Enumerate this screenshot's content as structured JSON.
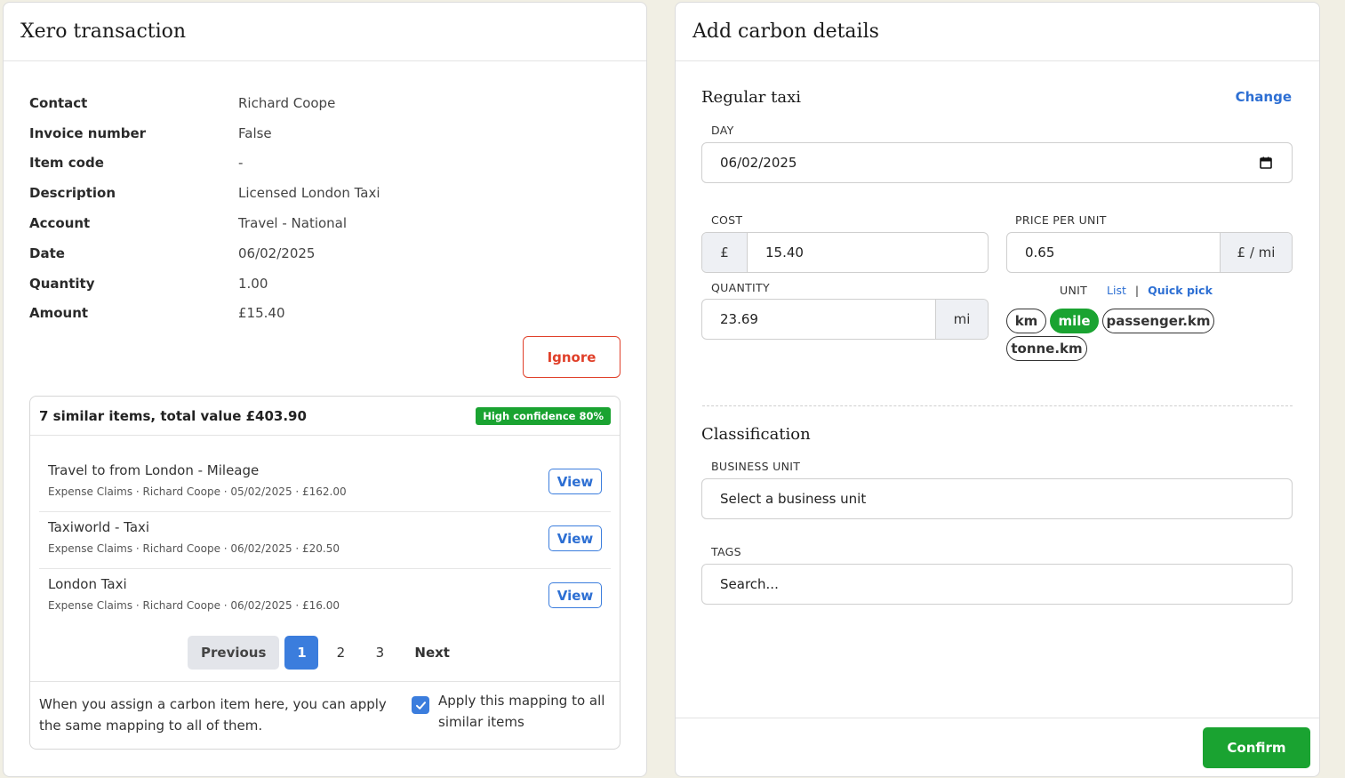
{
  "left": {
    "title": "Xero transaction",
    "details": [
      {
        "label": "Contact",
        "value": "Richard Coope"
      },
      {
        "label": "Invoice number",
        "value": "False"
      },
      {
        "label": "Item code",
        "value": "-"
      },
      {
        "label": "Description",
        "value": "Licensed London Taxi"
      },
      {
        "label": "Account",
        "value": "Travel - National"
      },
      {
        "label": "Date",
        "value": "06/02/2025"
      },
      {
        "label": "Quantity",
        "value": "1.00"
      },
      {
        "label": "Amount",
        "value": "£15.40"
      }
    ],
    "ignore_label": "Ignore",
    "similar": {
      "title": "7 similar items, total value £403.90",
      "confidence_badge": "High confidence 80%",
      "items": [
        {
          "name": "Travel to from London - Mileage",
          "meta": "Expense Claims · Richard Coope · 05/02/2025 · £162.00",
          "view_label": "View"
        },
        {
          "name": "Taxiworld - Taxi",
          "meta": "Expense Claims · Richard Coope · 06/02/2025 · £20.50",
          "view_label": "View"
        },
        {
          "name": "London Taxi",
          "meta": "Expense Claims · Richard Coope · 06/02/2025 · £16.00",
          "view_label": "View"
        }
      ],
      "pagination": {
        "previous": "Previous",
        "pages": [
          "1",
          "2",
          "3"
        ],
        "next": "Next"
      },
      "footer_text": "When you assign a carbon item here, you can apply the same mapping to all of them.",
      "apply_label": "Apply this mapping to all similar items"
    }
  },
  "right": {
    "title": "Add carbon details",
    "activity_name": "Regular taxi",
    "change_label": "Change",
    "day": {
      "label": "DAY",
      "value": "06/02/2025"
    },
    "cost": {
      "label": "COST",
      "currency": "£",
      "value": "15.40"
    },
    "price_per_unit": {
      "label": "PRICE PER UNIT",
      "value": "0.65",
      "unit": "£ / mi"
    },
    "quantity": {
      "label": "QUANTITY",
      "value": "23.69",
      "unit": "mi"
    },
    "unit": {
      "label": "UNIT",
      "list_link": "List",
      "separator": "|",
      "quick_pick_link": "Quick pick",
      "options": [
        "km",
        "mile",
        "passenger.km",
        "tonne.km"
      ],
      "selected": "mile"
    },
    "classification_title": "Classification",
    "business_unit": {
      "label": "BUSINESS UNIT",
      "placeholder": "Select a business unit"
    },
    "tags": {
      "label": "TAGS",
      "placeholder": "Search..."
    },
    "confirm_label": "Confirm"
  },
  "colors": {
    "accent_blue": "#3b7ddd",
    "success_green": "#1aa331",
    "danger_red": "#e0402a",
    "page_bg": "#f1efe4"
  }
}
